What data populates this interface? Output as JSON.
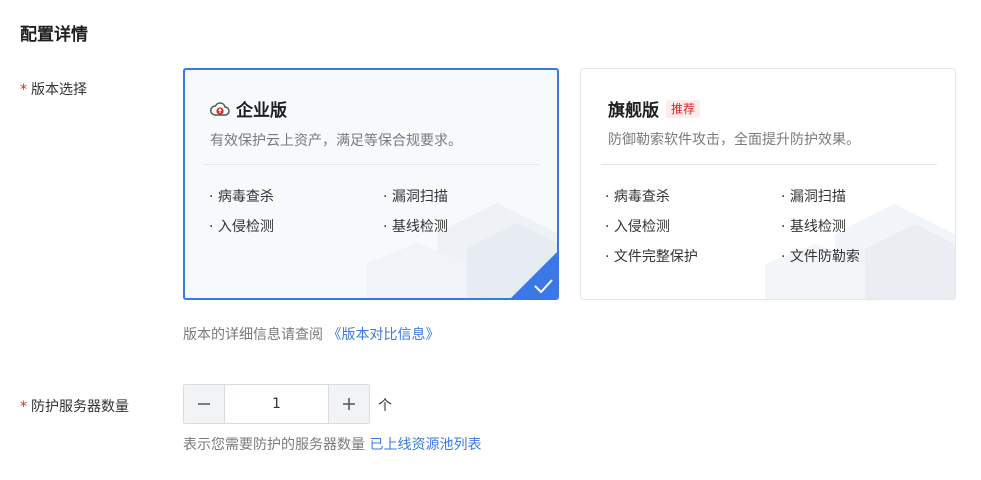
{
  "section": {
    "title": "配置详情"
  },
  "version": {
    "label": "版本选择",
    "required_mark": "*",
    "cards": [
      {
        "title": "企业版",
        "icon": "cloud-upload-icon",
        "selected": true,
        "description": "有效保护云上资产，满足等保合规要求。",
        "features": [
          "病毒查杀",
          "漏洞扫描",
          "入侵检测",
          "基线检测"
        ]
      },
      {
        "title": "旗舰版",
        "badge": "推荐",
        "selected": false,
        "description": "防御勒索软件攻击，全面提升防护效果。",
        "features": [
          "病毒查杀",
          "漏洞扫描",
          "入侵检测",
          "基线检测",
          "文件完整保护",
          "文件防勒索"
        ]
      }
    ],
    "hint_text": "版本的详细信息请查阅",
    "hint_link": "《版本对比信息》"
  },
  "servers": {
    "label": "防护服务器数量",
    "required_mark": "*",
    "value": "1",
    "unit": "个",
    "hint_text": "表示您需要防护的服务器数量",
    "hint_link": "已上线资源池列表"
  },
  "colors": {
    "accent": "#3b78e7",
    "required": "#e2231a",
    "badge_bg": "#fdecec"
  }
}
